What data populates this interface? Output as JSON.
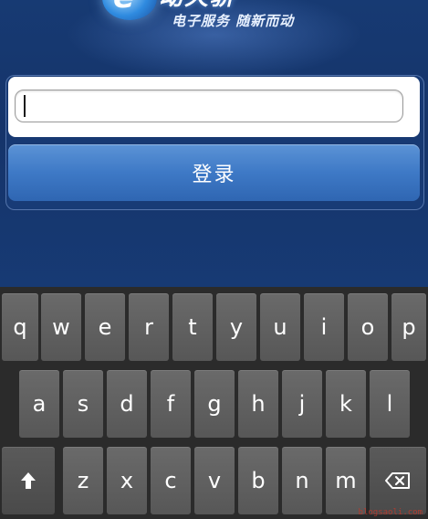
{
  "header": {
    "logo_letter": "e",
    "logo_word": "动天骄",
    "slogan": "电子服务 随新而动"
  },
  "login": {
    "input_value": "",
    "button_label": "登录"
  },
  "keyboard": {
    "row1": [
      "q",
      "w",
      "e",
      "r",
      "t",
      "y",
      "u",
      "i",
      "o",
      "p"
    ],
    "row2": [
      "a",
      "s",
      "d",
      "f",
      "g",
      "h",
      "j",
      "k",
      "l"
    ],
    "row3": [
      "z",
      "x",
      "c",
      "v",
      "b",
      "n",
      "m"
    ],
    "shift_icon": "shift-arrow-icon",
    "backspace_icon": "backspace-icon"
  },
  "watermark": "blogsaoli.com",
  "colors": {
    "app_background": "#173a73",
    "login_button": "#3e79c6",
    "key": "#5f5f5f",
    "keyboard_background": "#2b2b2b"
  }
}
